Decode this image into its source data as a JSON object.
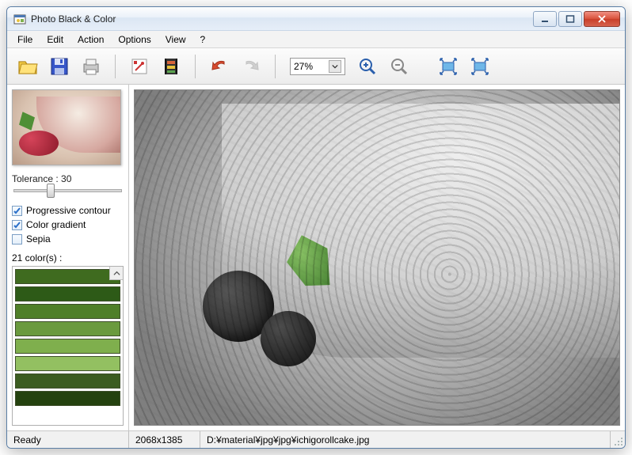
{
  "window": {
    "title": "Photo Black & Color"
  },
  "menu": {
    "file": "File",
    "edit": "Edit",
    "action": "Action",
    "options": "Options",
    "view": "View",
    "help": "?"
  },
  "toolbar": {
    "zoom_level": "27%"
  },
  "sidebar": {
    "tolerance_label": "Tolerance : 30",
    "tolerance_value": 30,
    "checks": {
      "progressive_contour": {
        "label": "Progressive contour",
        "checked": true
      },
      "color_gradient": {
        "label": "Color gradient",
        "checked": true
      },
      "sepia": {
        "label": "Sepia",
        "checked": false
      }
    },
    "colors_label": "21 color(s) :",
    "colors": [
      "#3f6b1f",
      "#2d5a17",
      "#4f7f28",
      "#6a9a3e",
      "#7faf4d",
      "#93c061",
      "#3b5c20",
      "#24420f"
    ]
  },
  "statusbar": {
    "ready": "Ready",
    "dimensions": "2068x1385",
    "filepath": "D:¥material¥jpg¥jpg¥ichigorollcake.jpg"
  }
}
